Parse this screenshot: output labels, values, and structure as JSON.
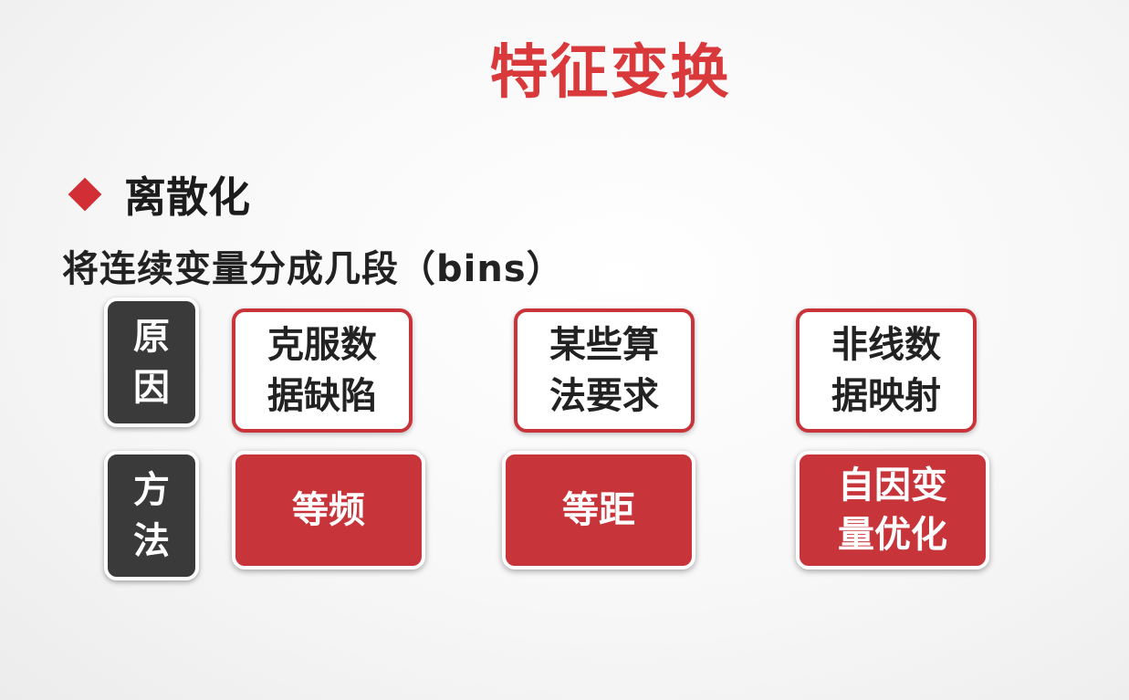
{
  "slide": {
    "title": "特征变换",
    "heading": "离散化",
    "subtitle": "将连续变量分成几段（bins）"
  },
  "rows": {
    "reason_label": "原\n因",
    "method_label": "方\n法"
  },
  "reasons": [
    "克服数\n据缺陷",
    "某些算\n法要求",
    "非线数\n据映射"
  ],
  "methods": [
    "等频",
    "等距",
    "自因变\n量优化"
  ],
  "colors": {
    "accent_red": "#d12f35",
    "dark_gray": "#3a3a3a",
    "text_dark": "#1c1c1c"
  }
}
